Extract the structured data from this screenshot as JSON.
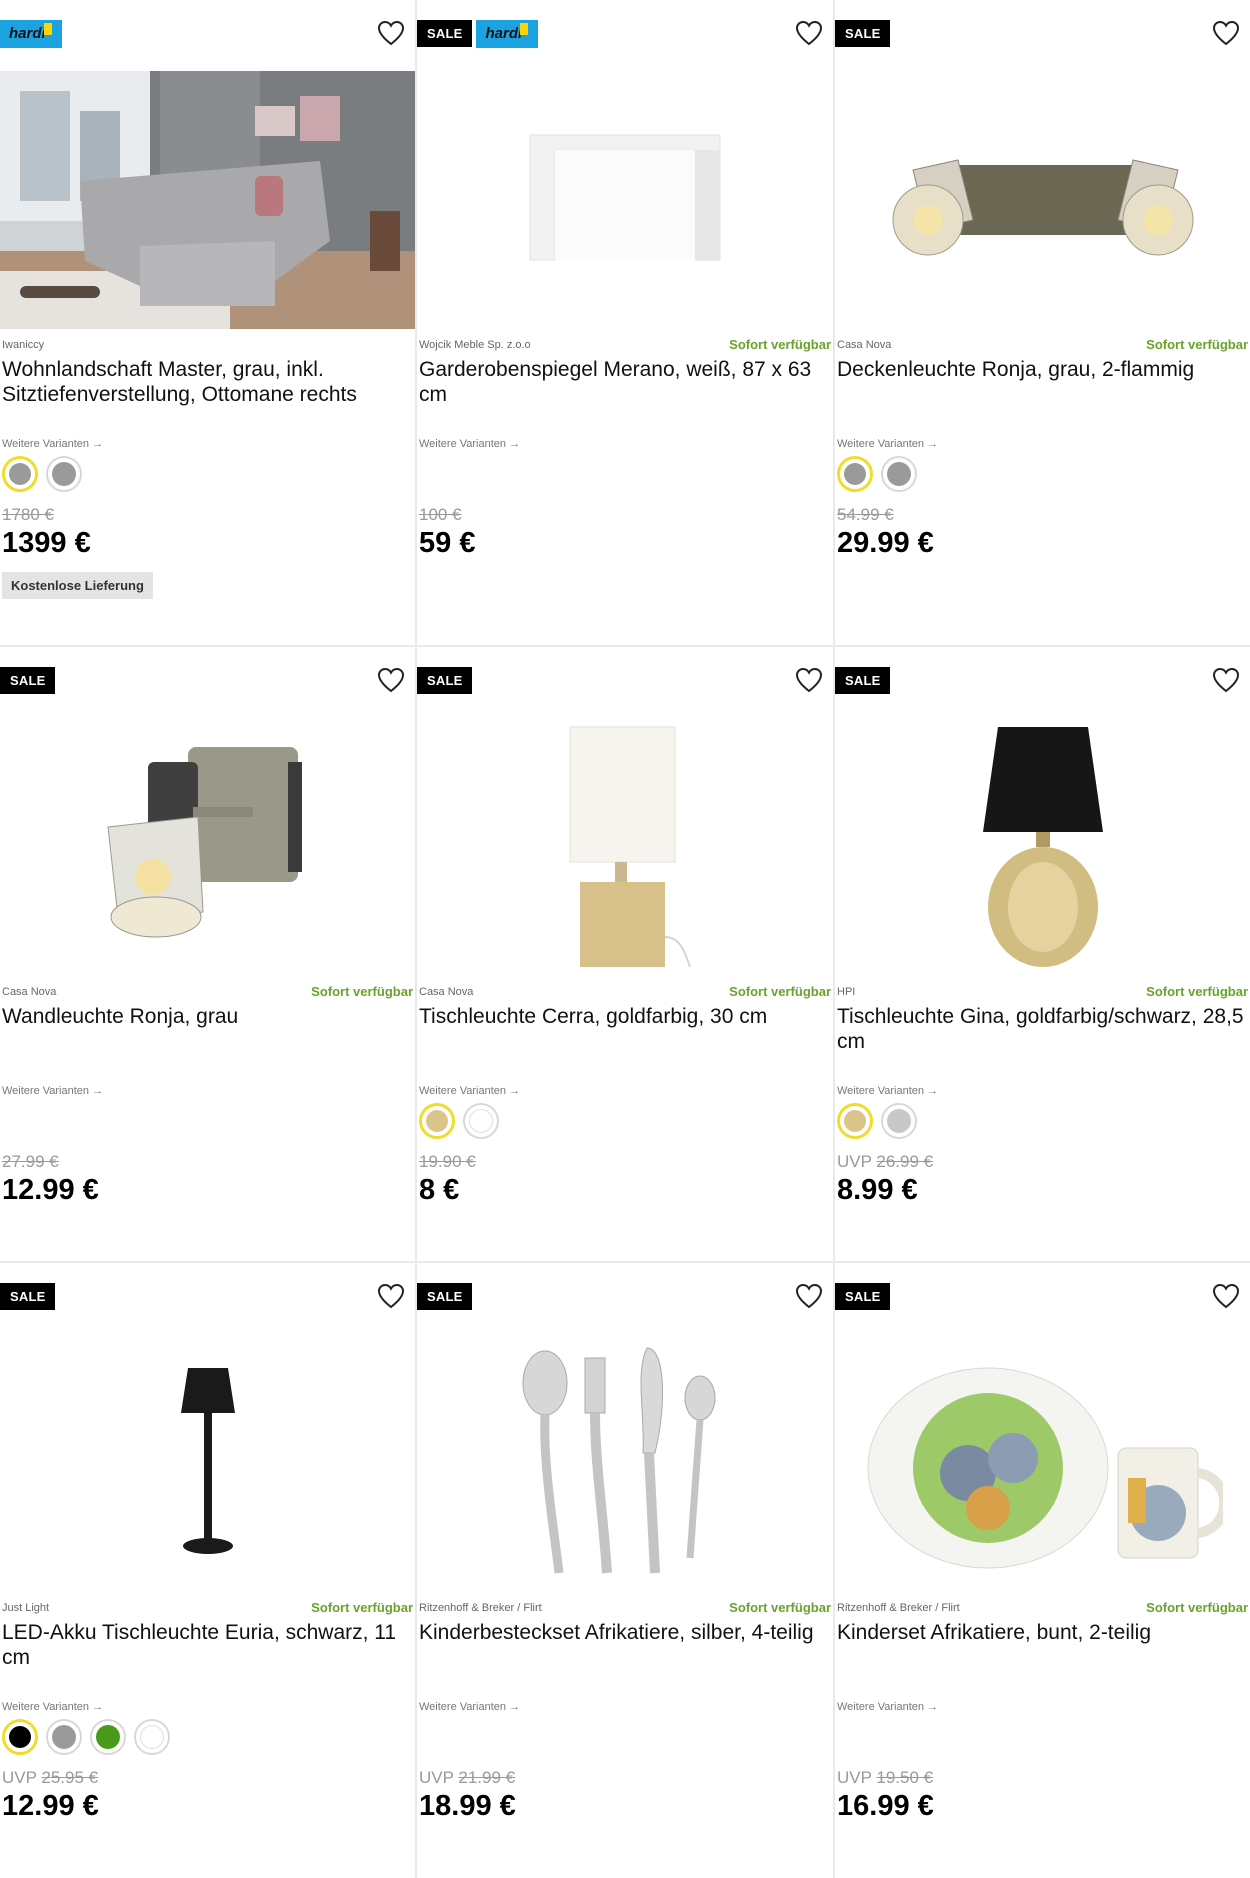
{
  "labels": {
    "sale": "SALE",
    "hardi": "hardi",
    "available": "Sofort verfügbar",
    "variants": "Weitere Varianten →",
    "uvp": "UVP",
    "free_delivery": "Kostenlose Lieferung"
  },
  "products": [
    {
      "brand": "Iwaniccy",
      "name": "Wohnlandschaft Master, grau, inkl. Sitztiefenverstellung, Ottomane rechts",
      "old_price": "1780 €",
      "price": "1399 €",
      "sale": false,
      "hardi": true,
      "available": false,
      "uvp": false,
      "free_delivery": true,
      "swatches": [
        "#9a9a9a",
        "#9a9a9a"
      ],
      "selected_swatch": 0,
      "image": "sofa-image"
    },
    {
      "brand": "Wojcik Meble Sp. z.o.o",
      "name": "Garderobenspiegel Merano, weiß, 87 x 63 cm",
      "old_price": "100 €",
      "price": "59 €",
      "sale": true,
      "hardi": true,
      "available": true,
      "uvp": false,
      "free_delivery": false,
      "swatches": [],
      "image": "mirror-image"
    },
    {
      "brand": "Casa Nova",
      "name": "Deckenleuchte Ronja, grau, 2-flammig",
      "old_price": "54.99 €",
      "price": "29.99 €",
      "sale": true,
      "hardi": false,
      "available": true,
      "uvp": false,
      "free_delivery": false,
      "swatches": [
        "#9a9a9a",
        "#9a9a9a"
      ],
      "selected_swatch": 0,
      "image": "ceiling-light-image"
    },
    {
      "brand": "Casa Nova",
      "name": "Wandleuchte Ronja, grau",
      "old_price": "27.99 €",
      "price": "12.99 €",
      "sale": true,
      "hardi": false,
      "available": true,
      "uvp": false,
      "free_delivery": false,
      "swatches": [],
      "image": "wall-light-image"
    },
    {
      "brand": "Casa Nova",
      "name": "Tischleuchte Cerra, goldfarbig, 30 cm",
      "old_price": "19.90 €",
      "price": "8 €",
      "sale": true,
      "hardi": false,
      "available": true,
      "uvp": false,
      "free_delivery": false,
      "swatches": [
        "#d9c58a",
        "#ffffff"
      ],
      "selected_swatch": 0,
      "image": "table-lamp-cerra-image"
    },
    {
      "brand": "HPI",
      "name": "Tischleuchte Gina, goldfarbig/schwarz, 28,5 cm",
      "old_price": "26.99 €",
      "price": "8.99 €",
      "sale": true,
      "hardi": false,
      "available": true,
      "uvp": true,
      "free_delivery": false,
      "swatches": [
        "#d9c58a",
        "#c8c8c8"
      ],
      "selected_swatch": 0,
      "image": "table-lamp-gina-image"
    },
    {
      "brand": "Just Light",
      "name": "LED-Akku Tischleuchte Euria, schwarz, 11 cm",
      "old_price": "25.95 €",
      "price": "12.99 €",
      "sale": true,
      "hardi": false,
      "available": true,
      "uvp": true,
      "free_delivery": false,
      "swatches": [
        "#000000",
        "#9a9a9a",
        "#4a9a1a",
        "#ffffff"
      ],
      "selected_swatch": 0,
      "image": "battery-lamp-image"
    },
    {
      "brand": "Ritzenhoff & Breker / Flirt",
      "name": "Kinderbesteckset Afrikatiere, silber, 4-teilig",
      "old_price": "21.99 €",
      "price": "18.99 €",
      "sale": true,
      "hardi": false,
      "available": true,
      "uvp": true,
      "free_delivery": false,
      "swatches": [],
      "image": "cutlery-image"
    },
    {
      "brand": "Ritzenhoff & Breker / Flirt",
      "name": "Kinderset Afrikatiere, bunt, 2-teilig",
      "old_price": "19.50 €",
      "price": "16.99 €",
      "sale": true,
      "hardi": false,
      "available": true,
      "uvp": true,
      "free_delivery": false,
      "swatches": [],
      "image": "kids-set-image"
    }
  ]
}
